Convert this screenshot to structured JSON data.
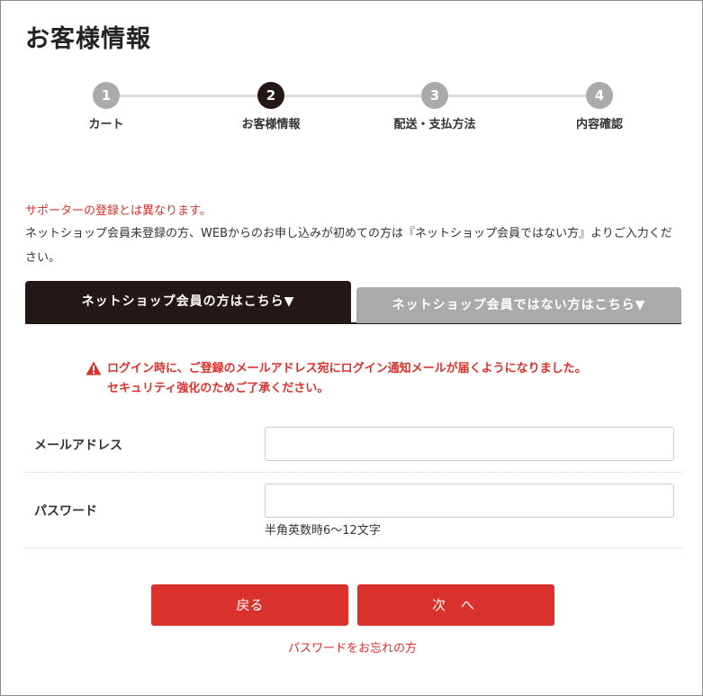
{
  "page": {
    "title": "お客様情報"
  },
  "stepper": {
    "steps": [
      {
        "number": "1",
        "label": "カート",
        "active": false
      },
      {
        "number": "2",
        "label": "お客様情報",
        "active": true
      },
      {
        "number": "3",
        "label": "配送・支払方法",
        "active": false
      },
      {
        "number": "4",
        "label": "内容確認",
        "active": false
      }
    ]
  },
  "notices": {
    "supporter": "サポーターの登録とは異なります。",
    "intro": "ネットショップ会員未登録の方、WEBからのお申し込みが初めての方は『ネットショップ会員ではない方』よりご入力ください。"
  },
  "tabs": {
    "member": "ネットショップ会員の方はこちら▼",
    "non_member": "ネットショップ会員ではない方はこちら▼"
  },
  "warning": {
    "icon": "warning-triangle-icon",
    "line1": "ログイン時に、ご登録のメールアドレス宛にログイン通知メールが届くようになりました。",
    "line2": "セキュリティ強化のためご了承ください。"
  },
  "form": {
    "email": {
      "label": "メールアドレス",
      "value": "",
      "placeholder": ""
    },
    "password": {
      "label": "パスワード",
      "value": "",
      "placeholder": "",
      "hint": "半角英数時6〜12文字"
    }
  },
  "buttons": {
    "back": "戻る",
    "next": "次 へ",
    "forgot": "パスワードをお忘れの方"
  },
  "colors": {
    "accent": "#d9322d",
    "dark": "#231815",
    "inactive": "#aaaaaa"
  }
}
